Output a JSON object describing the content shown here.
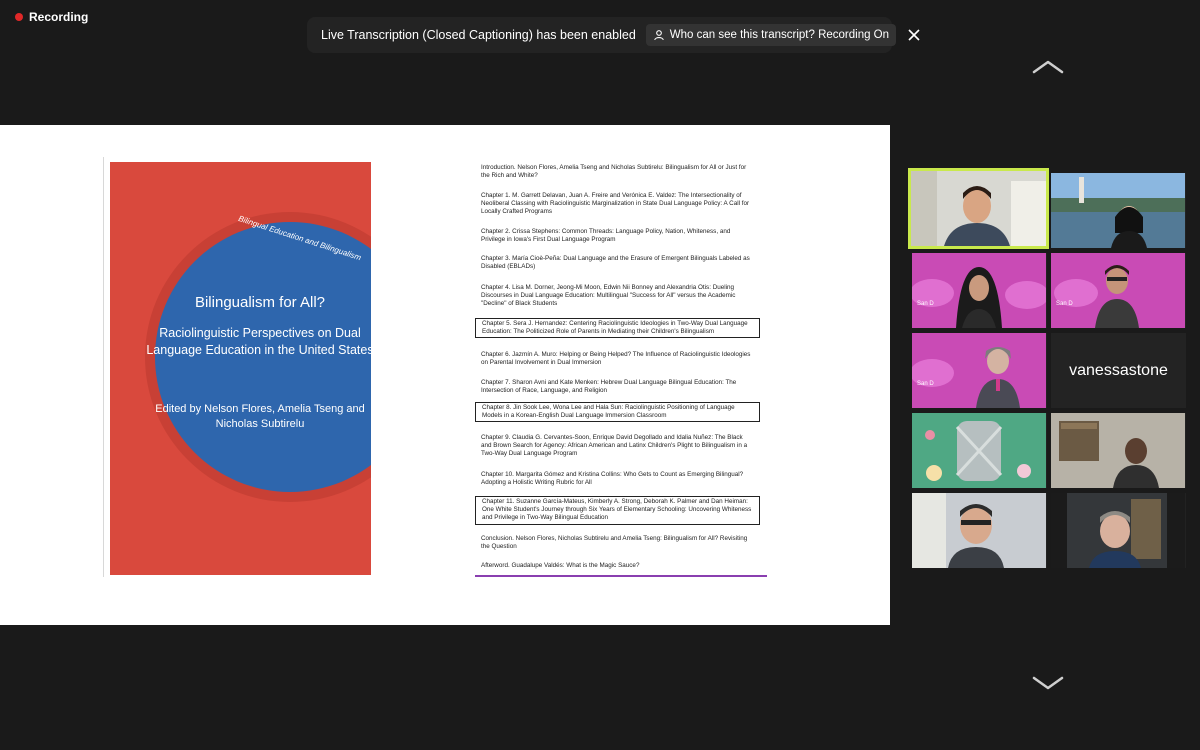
{
  "recording": {
    "label": "Recording"
  },
  "banner": {
    "message": "Live Transcription (Closed Captioning) has been enabled",
    "button_label": "Who can see this transcript? Recording On"
  },
  "slide": {
    "cover": {
      "series": "Bilingual Education and Bilingualism",
      "title": "Bilingualism for All?",
      "subtitle": "Raciolinguistic Perspectives on Dual Language Education in the United States",
      "editors": "Edited by Nelson Flores, Amelia Tseng and Nicholas Subtirelu"
    },
    "toc": [
      {
        "text": "Introduction. Nelson Flores, Amelia Tseng and Nicholas Subtirelu: Bilingualism for All or Just for the Rich and White?",
        "boxed": false
      },
      {
        "text": "Chapter 1. M. Garrett Delavan, Juan A. Freire and Verónica E. Valdez: The Intersectionality of Neoliberal Classing with Raciolinguistic Marginalization in State Dual Language Policy: A Call for Locally Crafted Programs",
        "boxed": false
      },
      {
        "text": "Chapter 2. Crissa Stephens: Common Threads: Language Policy, Nation, Whiteness, and Privilege in Iowa's First Dual Language Program",
        "boxed": false
      },
      {
        "text": "Chapter 3. María Cioè-Peña: Dual Language and the Erasure of Emergent Bilinguals Labeled as Disabled (EBLADs)",
        "boxed": false
      },
      {
        "text": "Chapter 4. Lisa M. Dorner, Jeong-Mi Moon, Edwin Nii Bonney and Alexandria Otis: Dueling Discourses in Dual Language Education: Multilingual \"Success for All\" versus the Academic \"Decline\" of Black Students",
        "boxed": false
      },
      {
        "text": "Chapter 5. Sera J. Hernandez: Centering Raciolinguistic Ideologies in Two-Way Dual Language Education: The Politicized Role of Parents in Mediating their Children's Bilingualism",
        "boxed": true
      },
      {
        "text": "Chapter 6. Jazmín A. Muro: Helping or Being Helped? The Influence of Raciolinguistic Ideologies on Parental Involvement in Dual Immersion",
        "boxed": false
      },
      {
        "text": "Chapter 7. Sharon Avni and Kate Menken: Hebrew Dual Language Bilingual Education: The Intersection of Race, Language, and Religion",
        "boxed": false
      },
      {
        "text": "Chapter 8. Jin Sook Lee, Wona Lee and Hala Sun: Raciolinguistic Positioning of Language Models in a Korean-English Dual Language Immersion Classroom",
        "boxed": true
      },
      {
        "text": "Chapter 9. Claudia G. Cervantes-Soon, Enrique David Degollado and Idalia Nuñez: The Black and Brown Search for Agency: African American and Latinx Children's Plight to Bilingualism in a Two-Way Dual Language Program",
        "boxed": false
      },
      {
        "text": "Chapter 10. Margarita Gómez and Kristina Collins: Who Gets to Count as Emerging Bilingual? Adopting a Holistic Writing Rubric for All",
        "boxed": false
      },
      {
        "text": "Chapter 11. Suzanne García-Mateus, Kimberly A. Strong, Deborah K. Palmer and Dan Heiman: One White Student's Journey through Six Years of Elementary Schooling: Uncovering Whiteness and Privilege in Two-Way Bilingual Education",
        "boxed": true
      },
      {
        "text": "Conclusion. Nelson Flores, Nicholas Subtirelu and Amelia Tseng: Bilingualism for All? Revisiting the Question",
        "boxed": false
      },
      {
        "text": "Afterword. Guadalupe Valdés: What is the Magic Sauce?",
        "boxed": false
      }
    ]
  },
  "gallery": {
    "name_tile": "vanessastone",
    "active_color": "#c9e94c",
    "virtual_bg_text": "San D"
  }
}
